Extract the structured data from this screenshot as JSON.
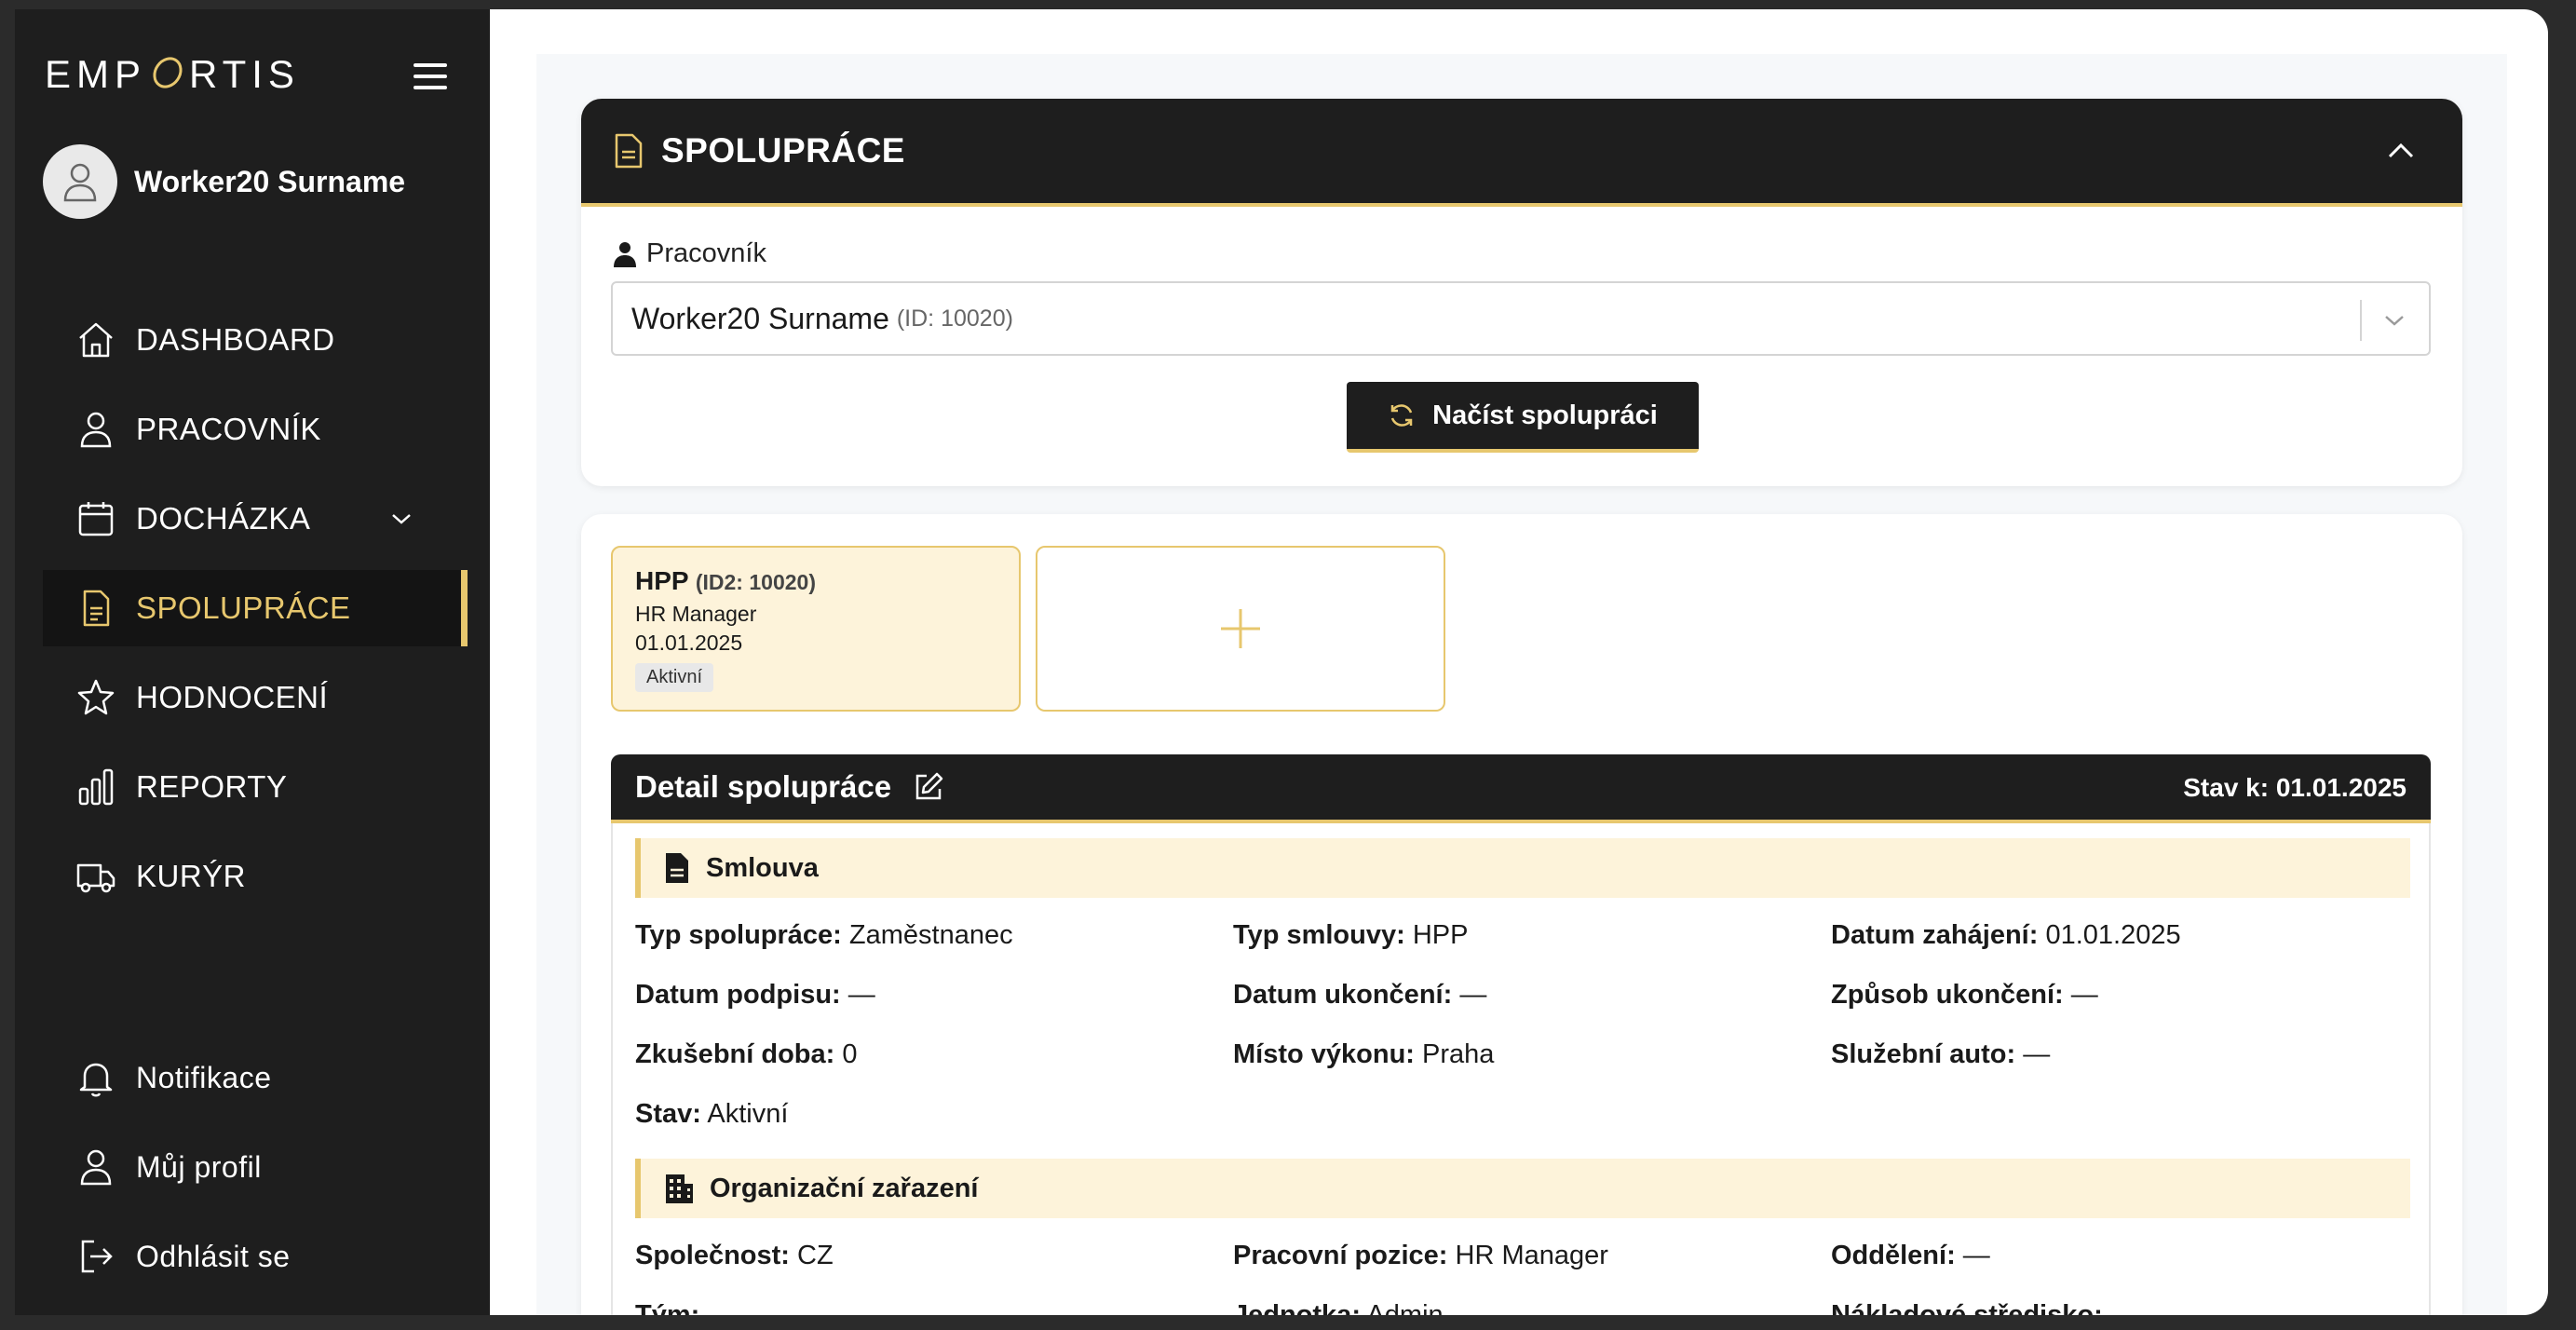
{
  "app": {
    "logo": "EMP",
    "logo_tail": "RTIS"
  },
  "user": {
    "name": "Worker20 Surname"
  },
  "nav": {
    "dashboard": "DASHBOARD",
    "worker": "PRACOVNÍK",
    "attendance": "DOCHÁZKA",
    "cooperation": "SPOLUPRÁCE",
    "rating": "HODNOCENÍ",
    "reports": "REPORTY",
    "courier": "KURÝR",
    "notifications": "Notifikace",
    "profile": "Můj profil",
    "logout": "Odhlásit se"
  },
  "panel": {
    "title": "SPOLUPRÁCE",
    "worker_label": "Pracovník",
    "worker_value": "Worker20 Surname",
    "worker_id": "(ID: 10020)",
    "load_button": "Načíst spolupráci"
  },
  "contracts": [
    {
      "type": "HPP",
      "id": "(ID2: 10020)",
      "position": "HR Manager",
      "date": "01.01.2025",
      "status": "Aktivní"
    }
  ],
  "detail": {
    "title": "Detail spolupráce",
    "state_as_of": "Stav k: 01.01.2025",
    "contract_section": "Smlouva",
    "org_section": "Organizační zařazení",
    "fields": {
      "typ_spoluprace": {
        "label": "Typ spolupráce:",
        "value": "Zaměstnanec"
      },
      "typ_smlouvy": {
        "label": "Typ smlouvy:",
        "value": "HPP"
      },
      "datum_zahajeni": {
        "label": "Datum zahájení:",
        "value": "01.01.2025"
      },
      "datum_podpisu": {
        "label": "Datum podpisu:",
        "value": "—"
      },
      "datum_ukonceni": {
        "label": "Datum ukončení:",
        "value": "—"
      },
      "zpusob_ukonceni": {
        "label": "Způsob ukončení:",
        "value": "—"
      },
      "zkusebni_doba": {
        "label": "Zkušební doba:",
        "value": "0"
      },
      "misto_vykonu": {
        "label": "Místo výkonu:",
        "value": "Praha"
      },
      "sluzebni_auto": {
        "label": "Služební auto:",
        "value": "—"
      },
      "stav": {
        "label": "Stav:",
        "value": "Aktivní"
      },
      "spolecnost": {
        "label": "Společnost:",
        "value": "CZ"
      },
      "pracovni_pozice": {
        "label": "Pracovní pozice:",
        "value": "HR Manager"
      },
      "oddeleni": {
        "label": "Oddělení:",
        "value": "—"
      },
      "tym": {
        "label": "Tým:",
        "value": ""
      },
      "jednotka": {
        "label": "Jednotka:",
        "value": "Admin"
      },
      "nakladove": {
        "label": "Nákladové středisko:",
        "value": ""
      }
    }
  },
  "colors": {
    "accent": "#e7c76e",
    "sidebar": "#1e1e1e",
    "highlight_bg": "#fdf3da"
  }
}
